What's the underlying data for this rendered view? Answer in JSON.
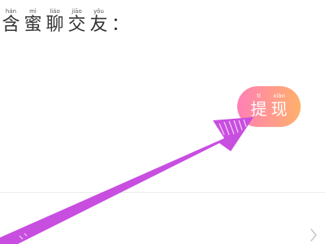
{
  "heading": {
    "chars": [
      {
        "hanzi": "含",
        "pinyin": "hán"
      },
      {
        "hanzi": "蜜",
        "pinyin": "mì"
      },
      {
        "hanzi": "聊",
        "pinyin": "liáo"
      },
      {
        "hanzi": "交",
        "pinyin": "jiāo"
      },
      {
        "hanzi": "友",
        "pinyin": "yǒu"
      }
    ],
    "colon": "："
  },
  "withdraw_button": {
    "chars": [
      {
        "hanzi": "提",
        "pinyin": "tí"
      },
      {
        "hanzi": "现",
        "pinyin": "xiàn"
      }
    ],
    "gradient": [
      "#ff7fb6",
      "#ffb06a"
    ]
  },
  "annotation_arrow": {
    "color": "#c84ee0"
  },
  "icons": {
    "arrow": "arrow-annotation-icon",
    "chevron": "chevron-right-icon"
  }
}
